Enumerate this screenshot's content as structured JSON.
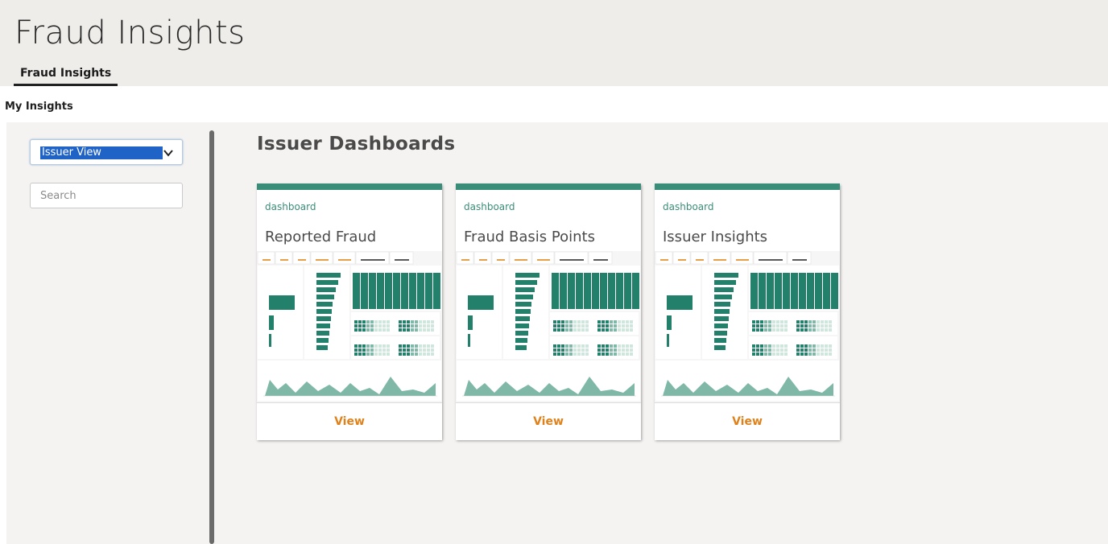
{
  "app": {
    "title": "Fraud Insights"
  },
  "tabs": [
    {
      "label": "Fraud Insights",
      "active": true
    }
  ],
  "section": {
    "label": "My Insights"
  },
  "sidebar": {
    "view_select": {
      "value": "Issuer View"
    },
    "search": {
      "placeholder": "Search"
    }
  },
  "main": {
    "heading": "Issuer Dashboards",
    "cards": [
      {
        "type": "dashboard",
        "title": "Reported Fraud",
        "action": "View"
      },
      {
        "type": "dashboard",
        "title": "Fraud Basis Points",
        "action": "View"
      },
      {
        "type": "dashboard",
        "title": "Issuer Insights",
        "action": "View"
      }
    ]
  },
  "colors": {
    "accent": "#3a8d78",
    "action": "#e0821c",
    "header_bg": "#efedea",
    "content_bg": "#f4f3f1",
    "select_highlight": "#1f63c6"
  },
  "icons": {
    "dropdown": "chevron-down-icon"
  }
}
